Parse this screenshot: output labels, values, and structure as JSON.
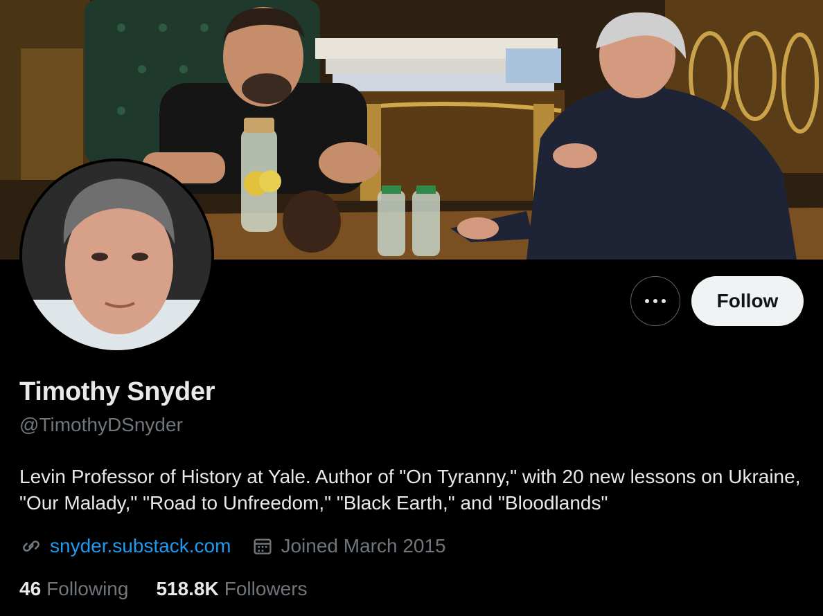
{
  "profile": {
    "name": "Timothy Snyder",
    "handle": "@TimothyDSnyder",
    "bio": "Levin Professor of History at Yale. Author of \"On Tyranny,\" with 20 new lessons on Ukraine, \"Our Malady,\" \"Road to Unfreedom,\" \"Black Earth,\" and \"Bloodlands\"",
    "website": "snyder.substack.com",
    "joined": "Joined March 2015"
  },
  "actions": {
    "follow_label": "Follow",
    "more_icon": "more-horizontal-icon"
  },
  "stats": {
    "following_count": "46",
    "following_label": "Following",
    "followers_count": "518.8K",
    "followers_label": "Followers"
  },
  "icons": {
    "website": "link-icon",
    "joined": "calendar-icon"
  },
  "colors": {
    "background": "#000000",
    "primary_text": "#e7e9ea",
    "secondary_text": "#71767b",
    "link": "#1d9bf0",
    "follow_button_bg": "#eff3f4",
    "follow_button_text": "#0f1419"
  }
}
